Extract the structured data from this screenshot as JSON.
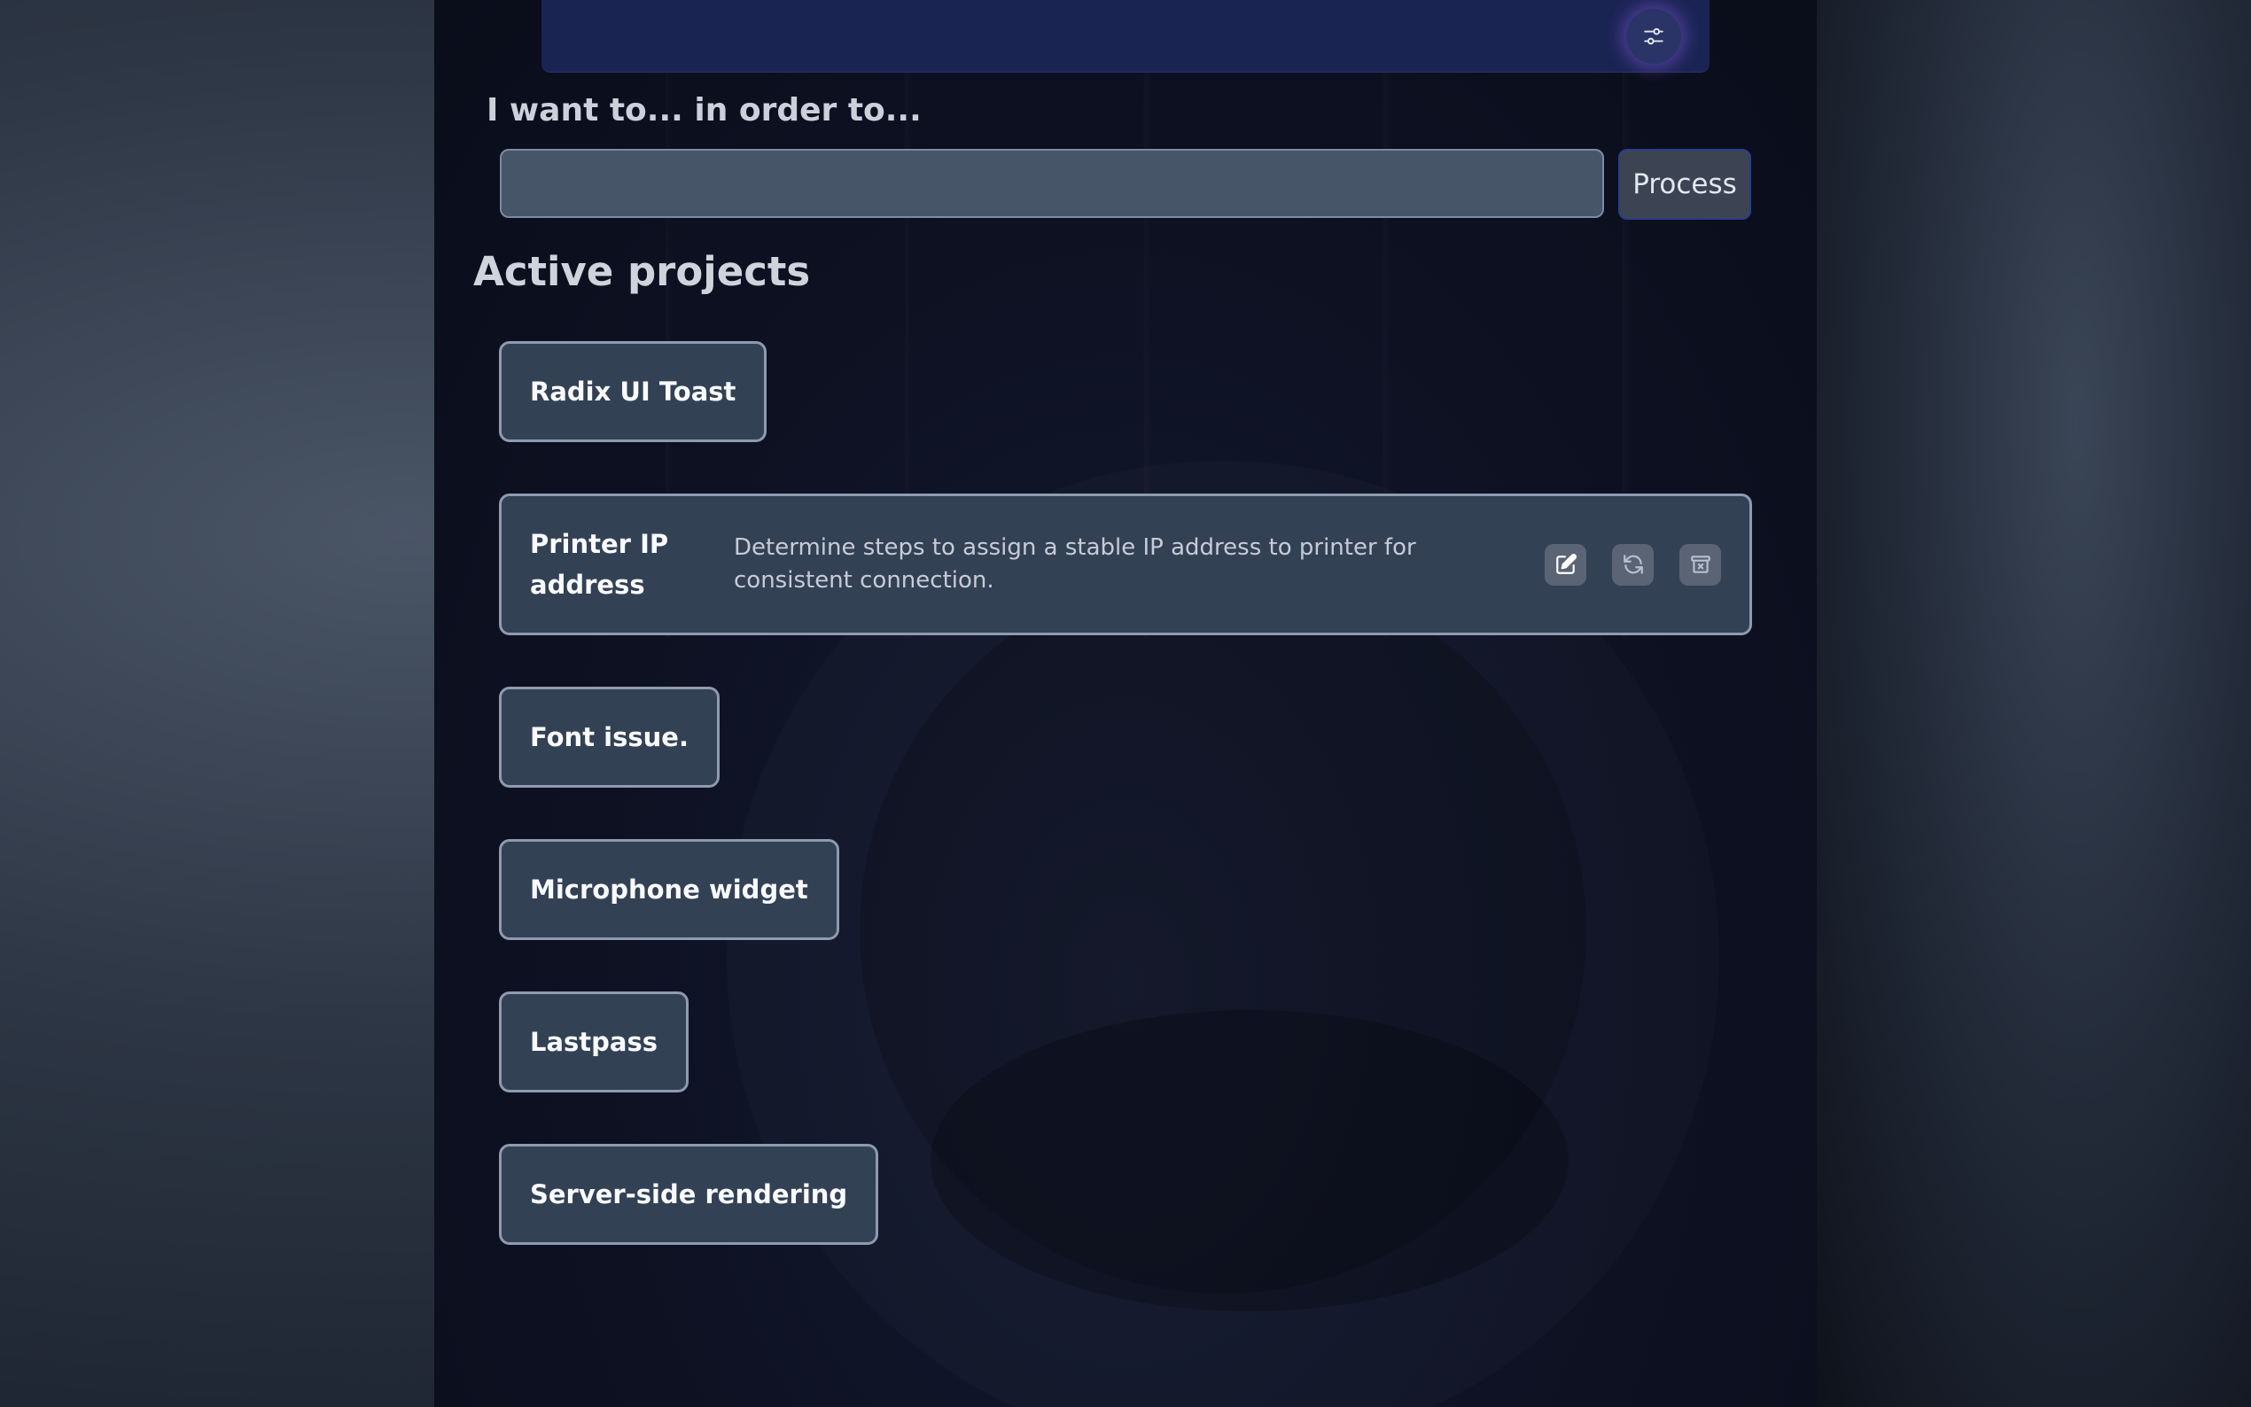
{
  "intent": {
    "label": "I want to... in order to...",
    "value": "",
    "placeholder": "",
    "process_label": "Process"
  },
  "projects": {
    "title": "Active projects",
    "items": [
      {
        "name": "Radix UI Toast"
      },
      {
        "name": "Printer IP address",
        "description": "Determine steps to assign a stable IP address to printer for consistent connection."
      },
      {
        "name": "Font issue."
      },
      {
        "name": "Microphone widget"
      },
      {
        "name": "Lastpass"
      },
      {
        "name": "Server-side rendering"
      }
    ]
  },
  "icons": {
    "filter": "sliders-icon",
    "edit": "edit-icon",
    "refresh": "refresh-icon",
    "archive": "archive-icon"
  },
  "colors": {
    "top_bar": "#1a2453",
    "card_bg": "#334155",
    "card_border": "#8e9ab0",
    "input_bg": "#475569",
    "filter_glow": "#8c5ae6"
  }
}
